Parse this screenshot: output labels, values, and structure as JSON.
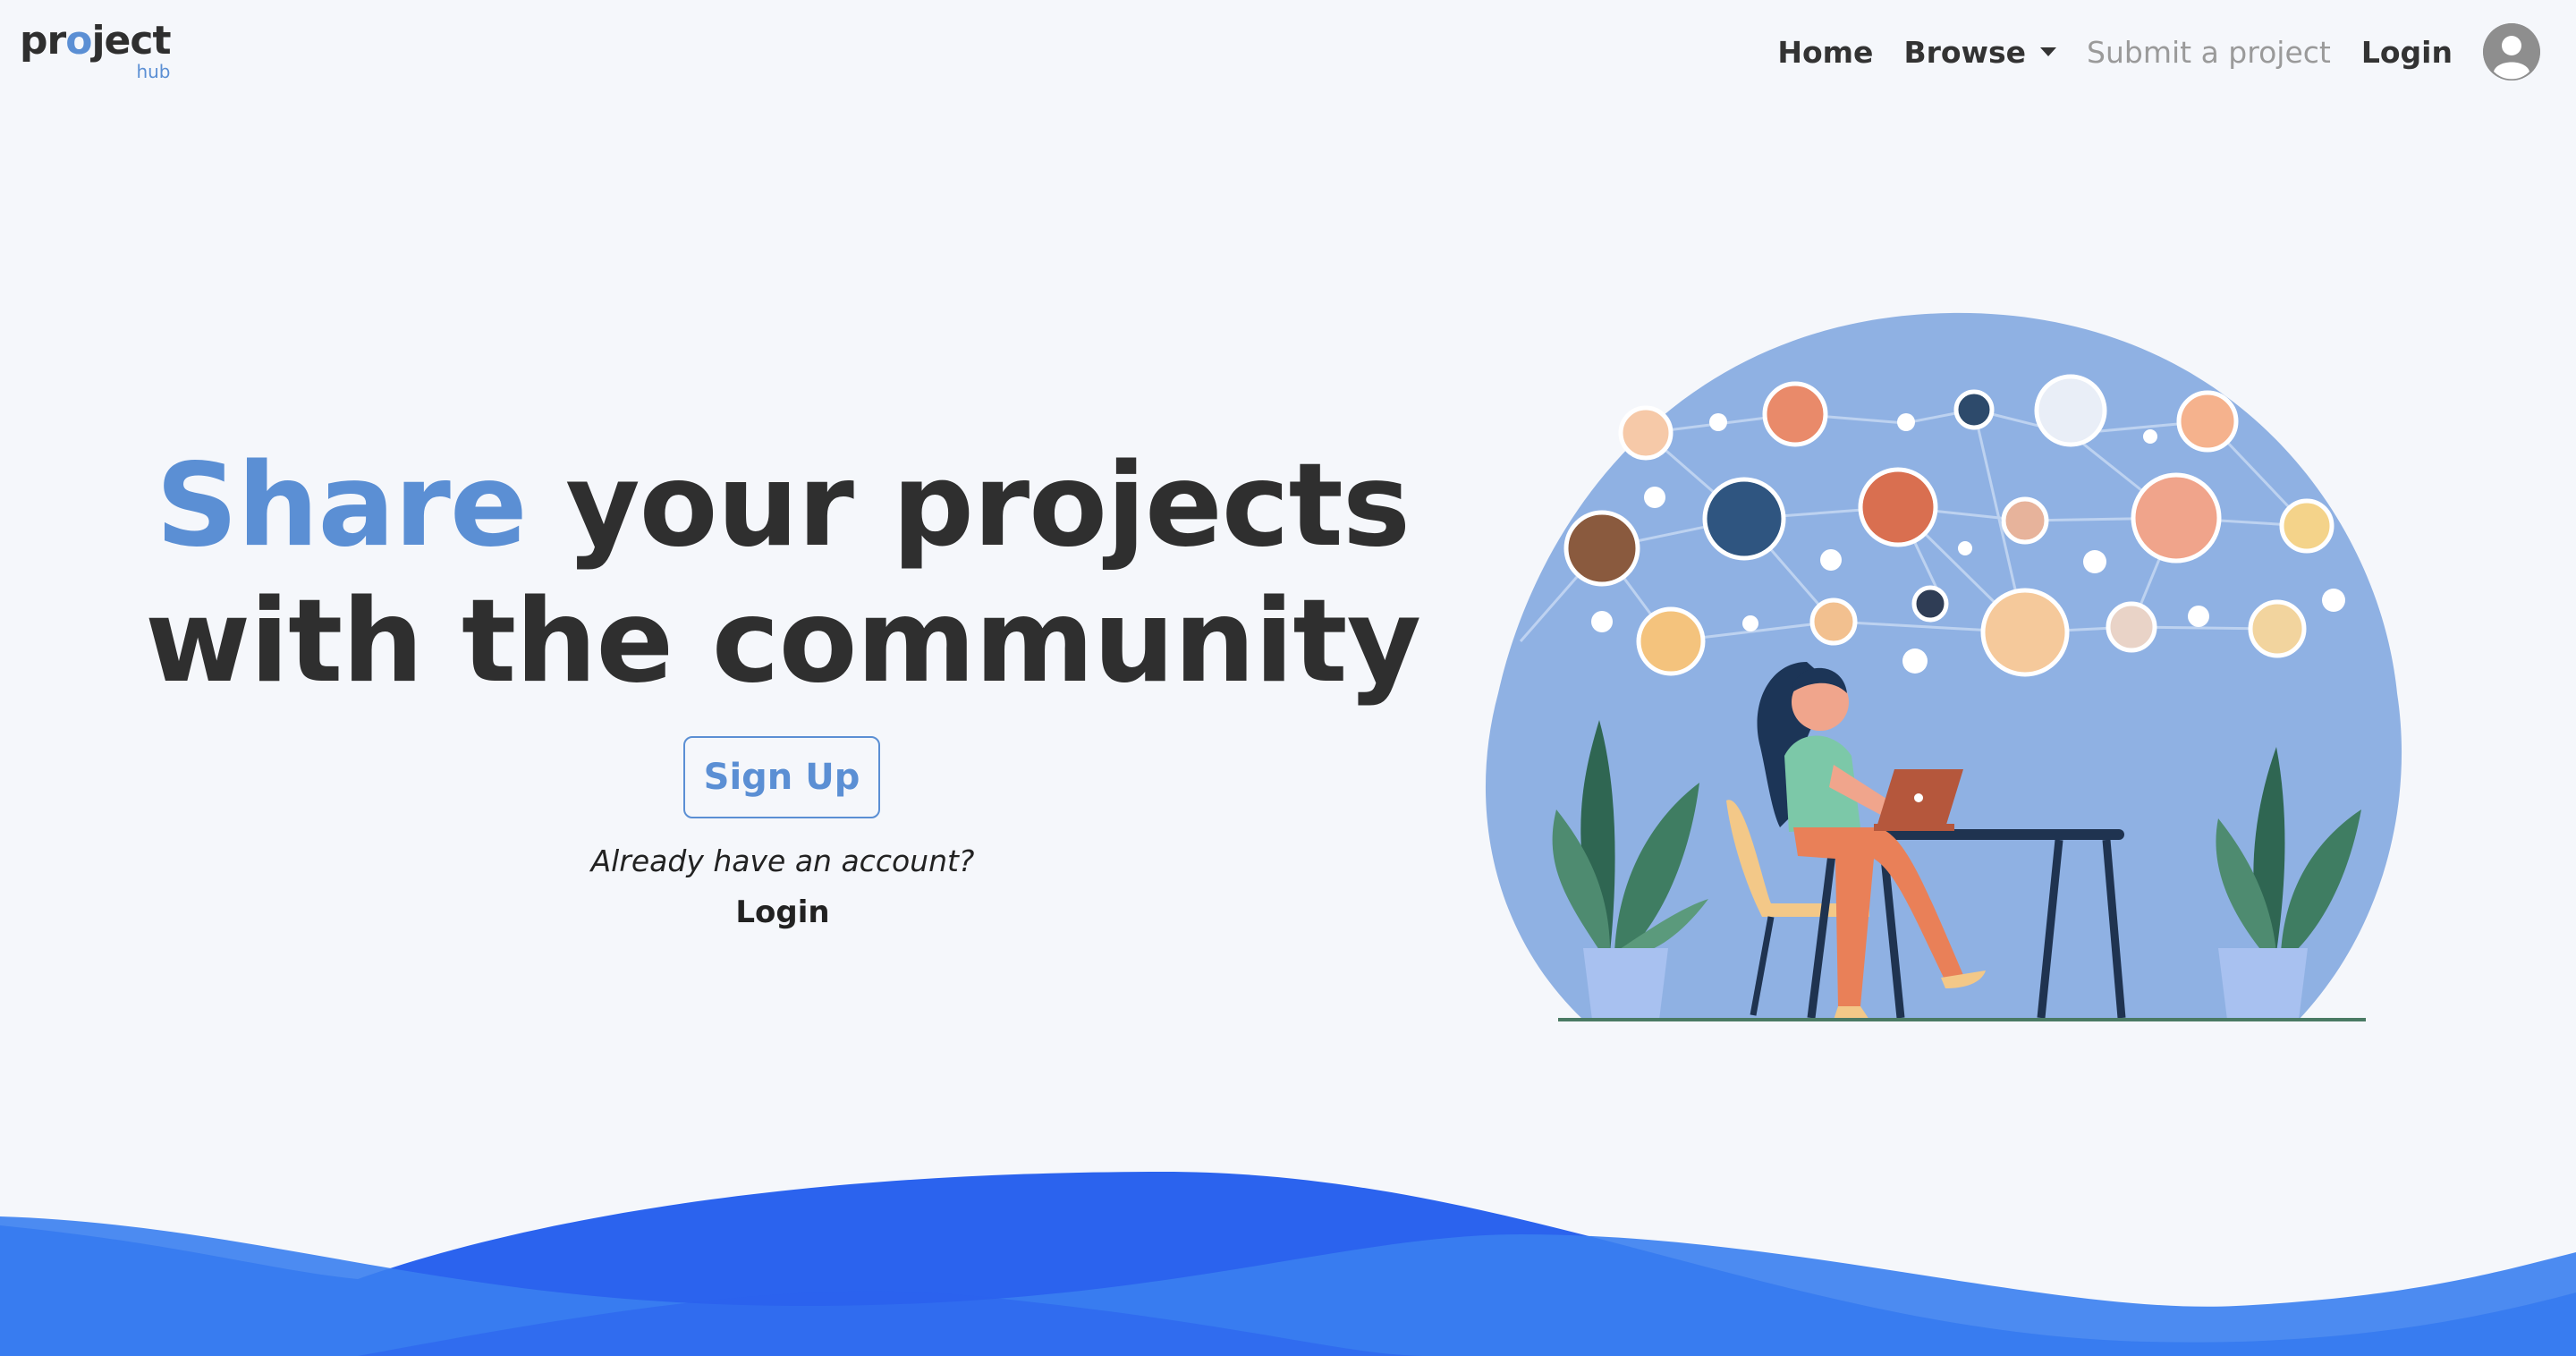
{
  "brand": {
    "logo_pre": "pr",
    "logo_o": "o",
    "logo_post": "ject",
    "logo_sub": "hub"
  },
  "nav": {
    "home": "Home",
    "browse": "Browse",
    "submit": "Submit a project",
    "login": "Login"
  },
  "hero": {
    "title_accent": "Share",
    "title_rest": " your projects",
    "title_line2": "with the community",
    "signup": "Sign Up",
    "already": "Already have an account?",
    "login": "Login"
  },
  "colors": {
    "accent": "#5b8fd4",
    "background": "#f5f7fb",
    "illustration_blob": "#8fb1e3",
    "wave_dark": "#2b63ee",
    "wave_light": "#3a7ef0"
  },
  "icons": {
    "user": "user-avatar-icon",
    "browse_dropdown": "caret-down-icon"
  }
}
